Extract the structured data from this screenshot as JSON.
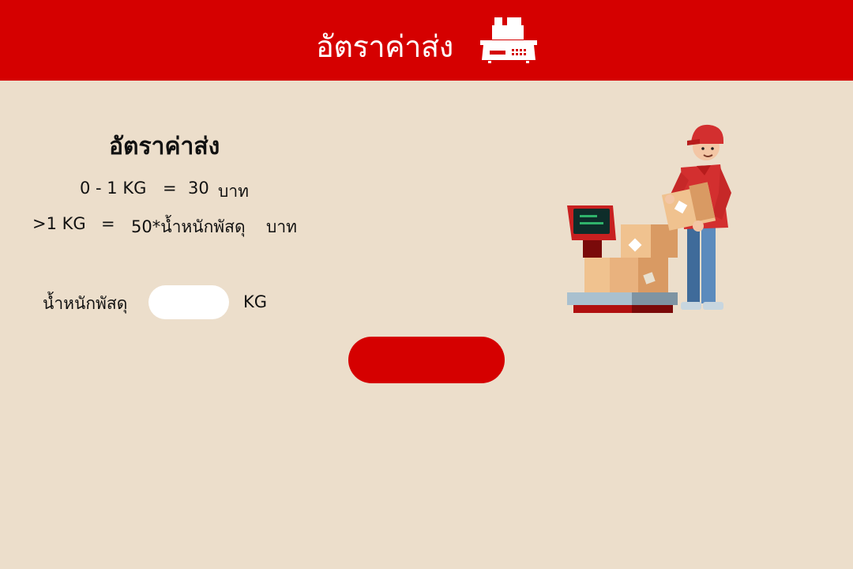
{
  "header": {
    "title": "อัตราค่าส่ง",
    "icon": "scale-icon",
    "background_color": "#d50000"
  },
  "rates": {
    "title": "อัตราค่าส่ง",
    "rows": [
      {
        "range": "0 - 1 KG",
        "equals": "=",
        "price": "30",
        "unit": "บาท"
      },
      {
        "range": ">1 KG",
        "equals": "=",
        "price": "50*น้ำหนักพัสดุ",
        "unit": "บาท"
      }
    ]
  },
  "form": {
    "weight_label": "น้ำหนักพัสดุ",
    "weight_value": "",
    "weight_unit": "KG",
    "submit_label": ""
  },
  "illustration": {
    "icon": "delivery-man-with-boxes-on-scale"
  },
  "colors": {
    "accent": "#d50000",
    "background": "#ecdecb"
  }
}
